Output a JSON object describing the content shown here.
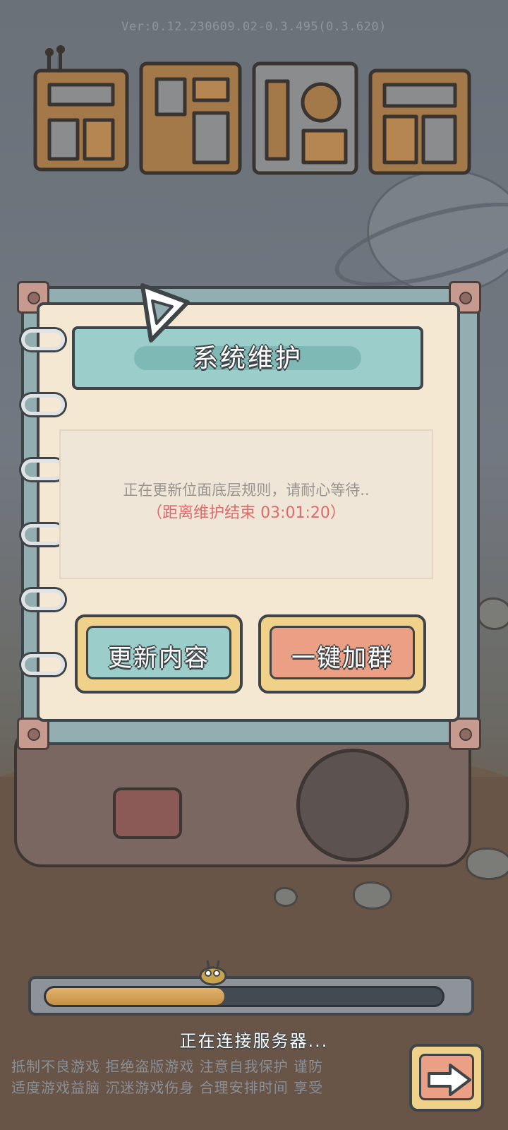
{
  "version": "Ver:0.12.230609.02-0.3.495(0.3.620)",
  "dialog": {
    "title": "系统维护",
    "message": "正在更新位面底层规则，请耐心等待..",
    "countdown": "（距离维护结束 03:01:20）",
    "buttons": {
      "update_content": "更新内容",
      "join_group": "一键加群"
    }
  },
  "loading": {
    "status": "正在连接服务器...",
    "progress": 0.45
  },
  "advisory": {
    "line1": "抵制不良游戏  拒绝盗版游戏  注意自我保护  谨防",
    "line2": "适度游戏益脑  沉迷游戏伤身  合理安排时间  享受"
  },
  "colors": {
    "panel_teal": "#9bcdca",
    "paper": "#f4e8d2",
    "update_button": "#9bcdca",
    "join_button": "#eb9f85",
    "countdown_red": "#e06a6a",
    "progress_fill": "#d9a55c"
  },
  "icons": {
    "next": "arrow-right-icon",
    "logo": "game-logo",
    "triangle": "triangle-badge-icon"
  }
}
